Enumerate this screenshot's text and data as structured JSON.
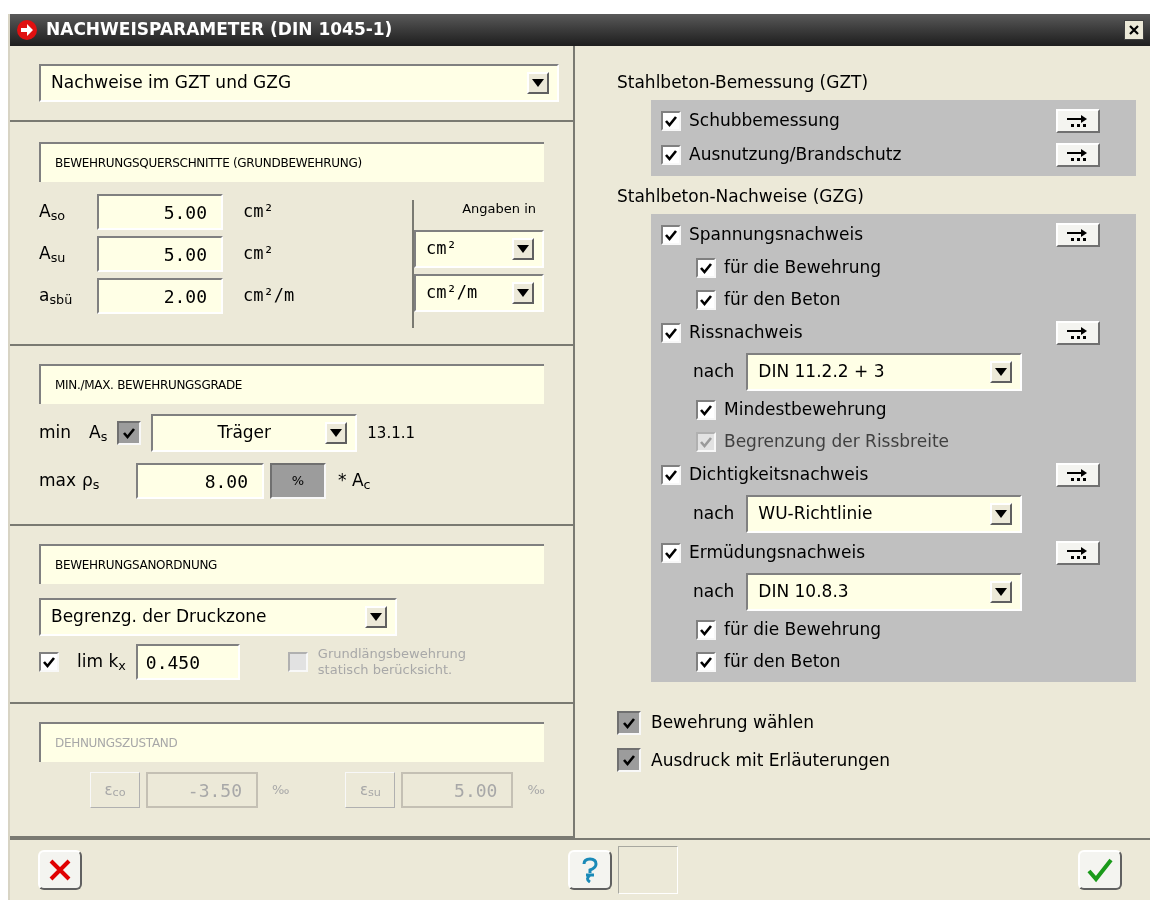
{
  "window": {
    "title": "NACHWEISPARAMETER (DIN 1045-1)"
  },
  "mode_select": {
    "value": "Nachweise im GZT und GZG"
  },
  "reinforcement_areas": {
    "heading": "BEWEHRUNGSQUERSCHNITTE (GRUNDBEWEHRUNG)",
    "rows": [
      {
        "symbol": "A$_{so}$",
        "value": "5.00",
        "unit": "cm²"
      },
      {
        "symbol": "A$_{su}$",
        "value": "5.00",
        "unit": "cm²"
      },
      {
        "symbol": "a$_{sbü}$",
        "value": "2.00",
        "unit": "cm²/m"
      }
    ],
    "units_label": "Angaben in",
    "unit_selects": [
      {
        "value": "cm²"
      },
      {
        "value": "cm²/m"
      }
    ]
  },
  "reinforcement_ratios": {
    "heading": "MIN./MAX. BEWEHRUNGSGRADE",
    "min_label": "min",
    "min_symbol": "A$_{s}$",
    "min_checked": true,
    "min_select": "Träger",
    "min_ref": "13.1.1",
    "max_label": "max",
    "max_symbol": "ρ$_{s}$",
    "max_value": "8.00",
    "max_unit": "%",
    "max_suffix": "* A$_{c}$"
  },
  "arrangement": {
    "heading": "BEWEHRUNGSANORDNUNG",
    "select": "Begrenzg. der Druckzone",
    "limit_checked": true,
    "limit_label": "lim k$_{x}$",
    "limit_value": "0.450",
    "base_option": {
      "label": "Grundlängsbewehrung statisch berücksicht.",
      "checked": false,
      "disabled": true
    }
  },
  "strain": {
    "heading": "DEHNUNGSZUSTAND",
    "disabled": true,
    "fields": [
      {
        "symbol": "ε$_{co}$",
        "value": "-3.50",
        "unit": "‰"
      },
      {
        "symbol": "ε$_{su}$",
        "value": "5.00",
        "unit": "‰"
      }
    ]
  },
  "design_gzt": {
    "heading": "Stahlbeton-Bemessung (GZT)",
    "items": [
      {
        "kind": "check",
        "label": "Schubbemessung",
        "checked": true,
        "disabled": false
      },
      {
        "kind": "check",
        "label": "Ausnutzung/Brandschutz",
        "checked": true,
        "disabled": false
      }
    ]
  },
  "checks_gzg": {
    "heading": "Stahlbeton-Nachweise (GZG)",
    "items": [
      {
        "kind": "check",
        "label": "Spannungsnachweis",
        "checked": true,
        "disabled": false
      },
      {
        "kind": "sub",
        "label": "für die Bewehrung",
        "checked": true,
        "disabled": false
      },
      {
        "kind": "sub",
        "label": "für den Beton",
        "checked": true,
        "disabled": false
      },
      {
        "kind": "check",
        "label": "Rissnachweis",
        "checked": true,
        "disabled": false
      },
      {
        "kind": "select",
        "label": "nach",
        "value": "DIN 11.2.2 + 3"
      },
      {
        "kind": "sub",
        "label": "Mindestbewehrung",
        "checked": true,
        "disabled": false
      },
      {
        "kind": "sub",
        "label": "Begrenzung der Rissbreite",
        "checked": true,
        "disabled": true
      },
      {
        "kind": "check",
        "label": "Dichtigkeitsnachweis",
        "checked": true,
        "disabled": false
      },
      {
        "kind": "select",
        "label": "nach",
        "value": "WU-Richtlinie"
      },
      {
        "kind": "check",
        "label": "Ermüdungsnachweis",
        "checked": true,
        "disabled": false
      },
      {
        "kind": "select",
        "label": "nach",
        "value": "DIN 10.8.3"
      },
      {
        "kind": "sub",
        "label": "für die Bewehrung",
        "checked": true,
        "disabled": false
      },
      {
        "kind": "sub",
        "label": "für den Beton",
        "checked": true,
        "disabled": false
      }
    ]
  },
  "options": [
    {
      "label": "Bewehrung wählen",
      "checked": true
    },
    {
      "label": "Ausdruck mit Erläuterungen",
      "checked": true
    }
  ]
}
